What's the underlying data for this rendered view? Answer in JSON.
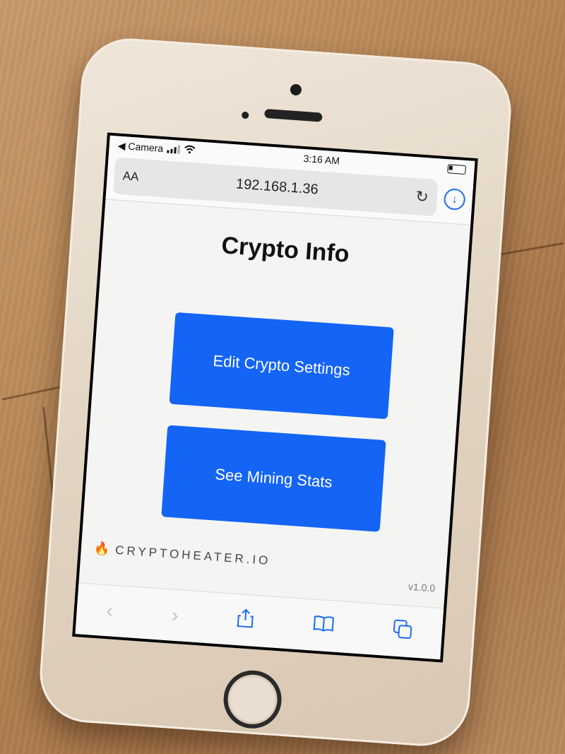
{
  "status_bar": {
    "back_app": "◀ Camera",
    "time": "3:16 AM"
  },
  "toolbar": {
    "text_size": "AA",
    "url": "192.168.1.36"
  },
  "page": {
    "title": "Crypto Info",
    "edit_button": "Edit Crypto Settings",
    "stats_button": "See Mining Stats",
    "brand": "CRYPTOHEATER.IO",
    "version": "v1.0.0"
  },
  "colors": {
    "button_blue": "#1464f6",
    "link_blue": "#1a6cf0",
    "page_background": "#f4f5f2"
  },
  "icons": [
    "signal-bars-icon",
    "wifi-icon",
    "battery-icon",
    "reload-icon",
    "download-icon",
    "back-arrow-icon",
    "forward-arrow-icon",
    "share-icon",
    "bookmarks-icon",
    "tabs-icon",
    "flame-icon"
  ]
}
